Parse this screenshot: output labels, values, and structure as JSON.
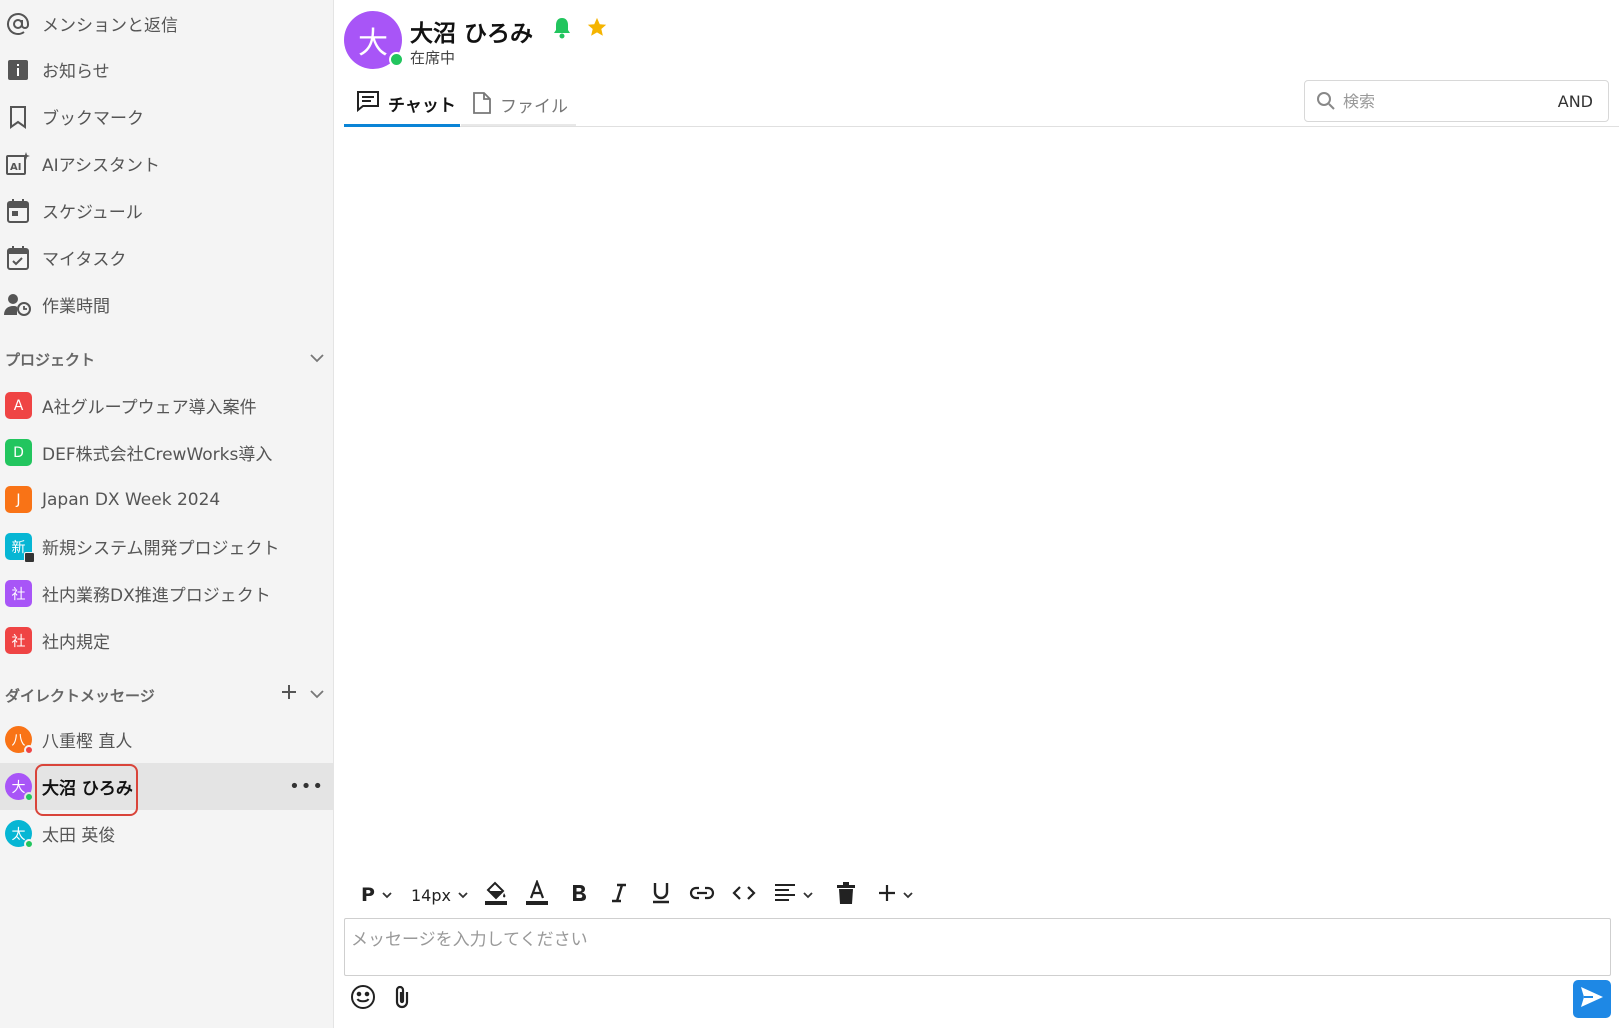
{
  "sidebar": {
    "nav": [
      {
        "label": "メンションと返信",
        "icon": "at-icon"
      },
      {
        "label": "お知らせ",
        "icon": "info-icon"
      },
      {
        "label": "ブックマーク",
        "icon": "bookmark-icon"
      },
      {
        "label": "AIアシスタント",
        "icon": "ai-assistant-icon"
      },
      {
        "label": "スケジュール",
        "icon": "calendar-icon"
      },
      {
        "label": "マイタスク",
        "icon": "task-check-icon"
      },
      {
        "label": "作業時間",
        "icon": "user-clock-icon"
      }
    ],
    "projects_heading": "プロジェクト",
    "projects": [
      {
        "initial": "A",
        "label": "A社グループウェア導入案件",
        "color": "#ef4444"
      },
      {
        "initial": "D",
        "label": "DEF株式会社CrewWorks導入",
        "color": "#22c55e"
      },
      {
        "initial": "J",
        "label": "Japan DX Week 2024",
        "color": "#f97316"
      },
      {
        "initial": "新",
        "label": "新規システム開発プロジェクト",
        "color": "#06b6d4"
      },
      {
        "initial": "社",
        "label": "社内業務DX推進プロジェクト",
        "color": "#a855f7"
      },
      {
        "initial": "社",
        "label": "社内規定",
        "color": "#ef4444"
      }
    ],
    "dm_heading": "ダイレクトメッセージ",
    "dms": [
      {
        "initial": "八",
        "label": "八重樫 直人",
        "color": "#f97316",
        "status_color": "#ef4444"
      },
      {
        "initial": "大",
        "label": "大沼 ひろみ",
        "color": "#a855f7",
        "status_color": "#22c55e"
      },
      {
        "initial": "太",
        "label": "太田 英俊",
        "color": "#06b6d4",
        "status_color": "#22c55e"
      }
    ],
    "more_label": "•••"
  },
  "header": {
    "avatar_initial": "大",
    "name": "大沼 ひろみ",
    "status": "在席中"
  },
  "tabs": [
    {
      "label": "チャット"
    },
    {
      "label": "ファイル"
    }
  ],
  "search": {
    "placeholder": "検索",
    "mode": "AND"
  },
  "toolbar": {
    "paragraph": "P",
    "font_size": "14px"
  },
  "composer": {
    "placeholder": "メッセージを入力してください"
  }
}
